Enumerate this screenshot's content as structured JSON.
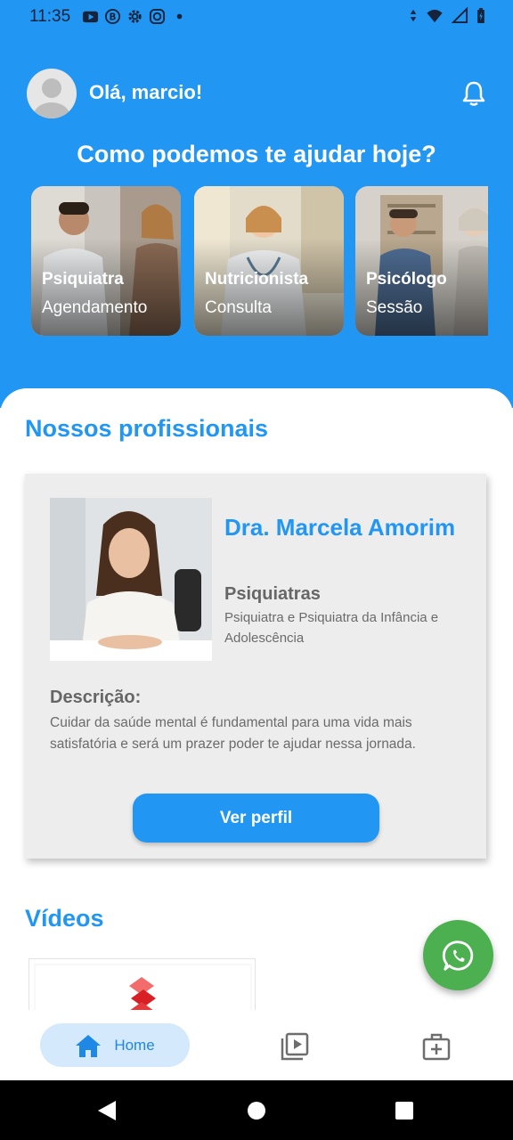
{
  "status_bar": {
    "time": "11:35",
    "left_icons": [
      "youtube-icon",
      "b-icon",
      "gear-icon",
      "instagram-icon",
      "dot-icon"
    ],
    "right_icons": [
      "data-arrows-icon",
      "wifi-icon",
      "signal-icon",
      "battery-icon"
    ]
  },
  "header": {
    "greeting": "Olá, marcio!",
    "help_title": "Como podemos te ajudar hoje?"
  },
  "service_cards": [
    {
      "title": "Psiquiatra",
      "subtitle": "Agendamento"
    },
    {
      "title": "Nutricionista",
      "subtitle": "Consulta"
    },
    {
      "title": "Psicólogo",
      "subtitle": "Sessão"
    }
  ],
  "professionals": {
    "section_title": "Nossos profissionais",
    "card": {
      "name": "Dra. Marcela Amorim",
      "role": "Psiquiatras",
      "specialty": "Psiquiatra e Psiquiatra da Infância e Adolescência",
      "description_label": "Descrição:",
      "description": "Cuidar da saúde mental é fundamental para uma vida mais satisfatória e será um prazer poder te ajudar nessa jornada.",
      "button_label": "Ver perfil"
    }
  },
  "videos": {
    "section_title": "Vídeos"
  },
  "bottom_nav": {
    "home_label": "Home"
  },
  "colors": {
    "primary": "#2196F3",
    "whatsapp": "#4CAF50",
    "card_bg": "#ededed"
  }
}
